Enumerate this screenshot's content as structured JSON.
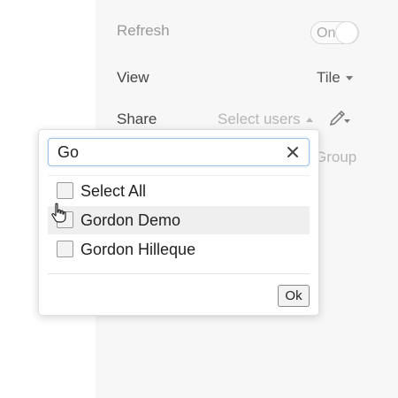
{
  "settings": {
    "refresh": {
      "label": "Refresh",
      "toggle_text": "On"
    },
    "view": {
      "label": "View",
      "value": "Tile"
    },
    "share": {
      "label": "Share",
      "placeholder": "Select users"
    },
    "group_text": "Group"
  },
  "popup": {
    "search": {
      "value": "Go"
    },
    "items": [
      {
        "label": "Select All",
        "checked": false
      },
      {
        "label": "Gordon Demo",
        "checked": false,
        "hovered": true
      },
      {
        "label": "Gordon Hilleque",
        "checked": false
      }
    ],
    "ok_label": "Ok"
  },
  "icons": {
    "clear": "close-icon",
    "edit": "pencil-icon",
    "pointer": "hand-pointer-icon"
  }
}
